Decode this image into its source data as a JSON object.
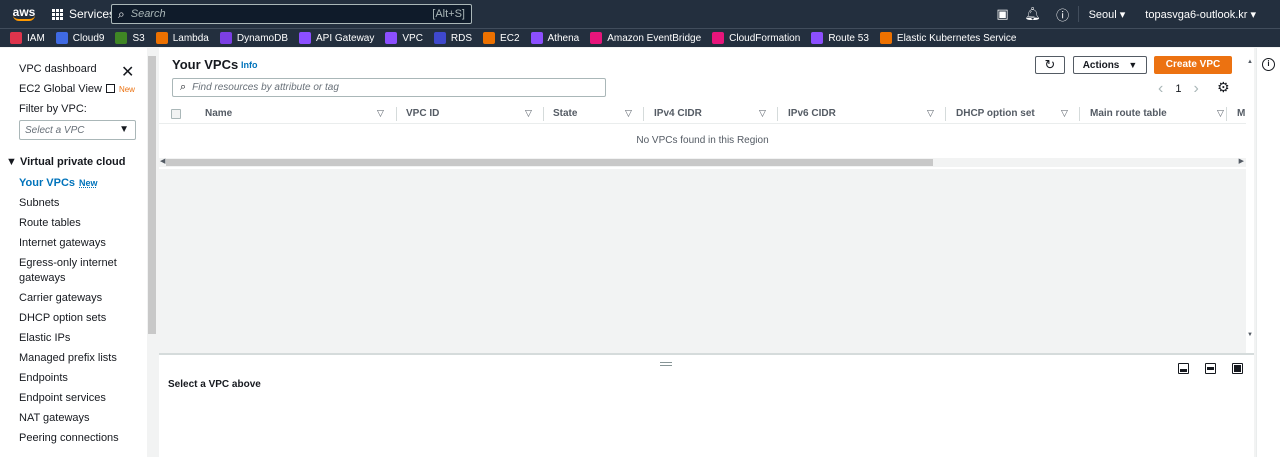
{
  "topnav": {
    "logo": "aws",
    "services_label": "Services",
    "search_placeholder": "Search",
    "search_shortcut": "[Alt+S]",
    "region": "Seoul",
    "account": "topasvga6-outlook.kr",
    "icons": [
      "cloudshell-icon",
      "bell-icon",
      "help-icon"
    ]
  },
  "favorites": [
    {
      "label": "IAM",
      "color": "#dd344c"
    },
    {
      "label": "Cloud9",
      "color": "#3f6ae3"
    },
    {
      "label": "S3",
      "color": "#3f8624"
    },
    {
      "label": "Lambda",
      "color": "#ed7100"
    },
    {
      "label": "DynamoDB",
      "color": "#7b3fe4"
    },
    {
      "label": "API Gateway",
      "color": "#8c4fff"
    },
    {
      "label": "VPC",
      "color": "#8c4fff"
    },
    {
      "label": "RDS",
      "color": "#3f48cc"
    },
    {
      "label": "EC2",
      "color": "#ed7100"
    },
    {
      "label": "Athena",
      "color": "#8c4fff"
    },
    {
      "label": "Amazon EventBridge",
      "color": "#e7157b"
    },
    {
      "label": "CloudFormation",
      "color": "#e7157b"
    },
    {
      "label": "Route 53",
      "color": "#8c4fff"
    },
    {
      "label": "Elastic Kubernetes Service",
      "color": "#ed7100"
    }
  ],
  "sidebar": {
    "dashboard": "VPC dashboard",
    "global_view": "EC2 Global View",
    "global_view_badge": "New",
    "filter_label": "Filter by VPC:",
    "filter_placeholder": "Select a VPC",
    "section": "Virtual private cloud",
    "your_vpcs": "Your VPCs",
    "your_vpcs_badge": "New",
    "items": [
      "Subnets",
      "Route tables",
      "Internet gateways",
      "Egress-only internet",
      "gateways",
      "Carrier gateways",
      "DHCP option sets",
      "Elastic IPs",
      "Managed prefix lists",
      "Endpoints",
      "Endpoint services",
      "NAT gateways",
      "Peering connections"
    ]
  },
  "main": {
    "title": "Your VPCs",
    "info": "Info",
    "actions_label": "Actions",
    "create_label": "Create VPC",
    "filter_placeholder": "Find resources by attribute or tag",
    "page_number": "1",
    "columns": [
      "Name",
      "VPC ID",
      "State",
      "IPv4 CIDR",
      "IPv6 CIDR",
      "DHCP option set",
      "Main route table",
      "M"
    ],
    "empty_message": "No VPCs found in this Region"
  },
  "detail": {
    "title": "Select a VPC above"
  },
  "colors": {
    "nav_bg": "#232f3e",
    "accent_orange": "#ec7211",
    "link_blue": "#0073bb"
  }
}
